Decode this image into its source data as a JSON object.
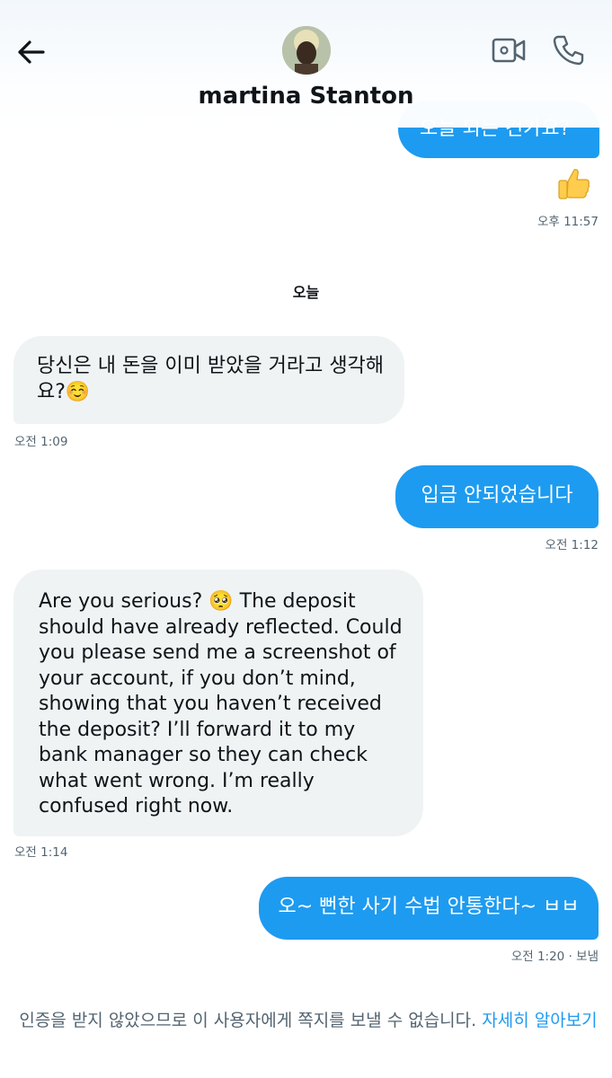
{
  "header": {
    "contact_name": "martina Stanton",
    "icons": {
      "back": "arrow-left-icon",
      "video": "video-camera-icon",
      "call": "phone-icon"
    }
  },
  "messages": [
    {
      "id": "m0",
      "direction": "out",
      "text": "오늘 되는 건가요?",
      "partially_visible": true
    },
    {
      "id": "m1",
      "direction": "out",
      "type": "emoji",
      "emoji": "👍",
      "timestamp": "오후 11:57"
    },
    {
      "id": "m2",
      "direction": "in",
      "lines": [
        "당신은 내 돈을 이미 받았을 거라고 생각해",
        "요?☺️"
      ],
      "timestamp": "오전 1:09"
    },
    {
      "id": "m3",
      "direction": "out",
      "text": "입금 안되었습니다",
      "timestamp": "오전 1:12"
    },
    {
      "id": "m4",
      "direction": "in",
      "lines": [
        "Are you serious? 🥺 The deposit",
        "should have already reflected. Could",
        "you please send me a screenshot of",
        "your account, if you don’t mind,",
        "showing that you haven’t received",
        "the deposit? I’ll forward it to my",
        "bank manager so they can check",
        "what went wrong. I’m really",
        "confused right now."
      ],
      "timestamp": "오전 1:14"
    },
    {
      "id": "m5",
      "direction": "out",
      "text": "오~ 뻔한 사기 수법 안통한다~ ㅂㅂ",
      "timestamp": "오전 1:20 · 보냄"
    }
  ],
  "day_separator": "오늘",
  "footer": {
    "notice": "인증을 받지 않았으므로 이 사용자에게 쪽지를 보낼 수 없습니다.",
    "link_text": "자세히 알아보기"
  },
  "colors": {
    "accent": "#1d9bf0",
    "incoming_bubble": "#eff3f4",
    "text": "#0f1419",
    "secondary_text": "#536471"
  }
}
